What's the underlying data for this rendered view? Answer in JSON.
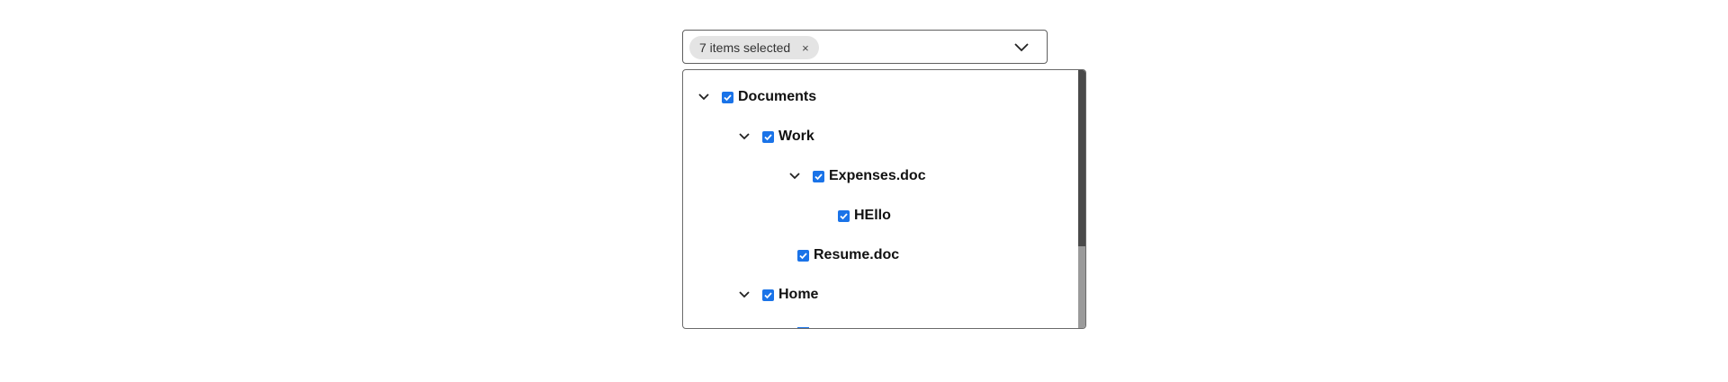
{
  "select": {
    "chip_label": "7 items selected",
    "chip_close": "×"
  },
  "tree": {
    "items": [
      {
        "label": "Documents",
        "checked": true,
        "expanded": true
      },
      {
        "label": "Work",
        "checked": true,
        "expanded": true
      },
      {
        "label": "Expenses.doc",
        "checked": true,
        "expanded": true
      },
      {
        "label": "HEllo",
        "checked": true
      },
      {
        "label": "Resume.doc",
        "checked": true
      },
      {
        "label": "Home",
        "checked": true,
        "expanded": true
      }
    ]
  },
  "colors": {
    "checkbox": "#1a73e8",
    "scroll_thumb": "#4a4a4a",
    "scroll_track": "#9a9a9a"
  },
  "icons": {
    "toggle": "chevron-down-icon",
    "dropdown": "chevron-down-icon",
    "chip_close": "close-icon"
  }
}
